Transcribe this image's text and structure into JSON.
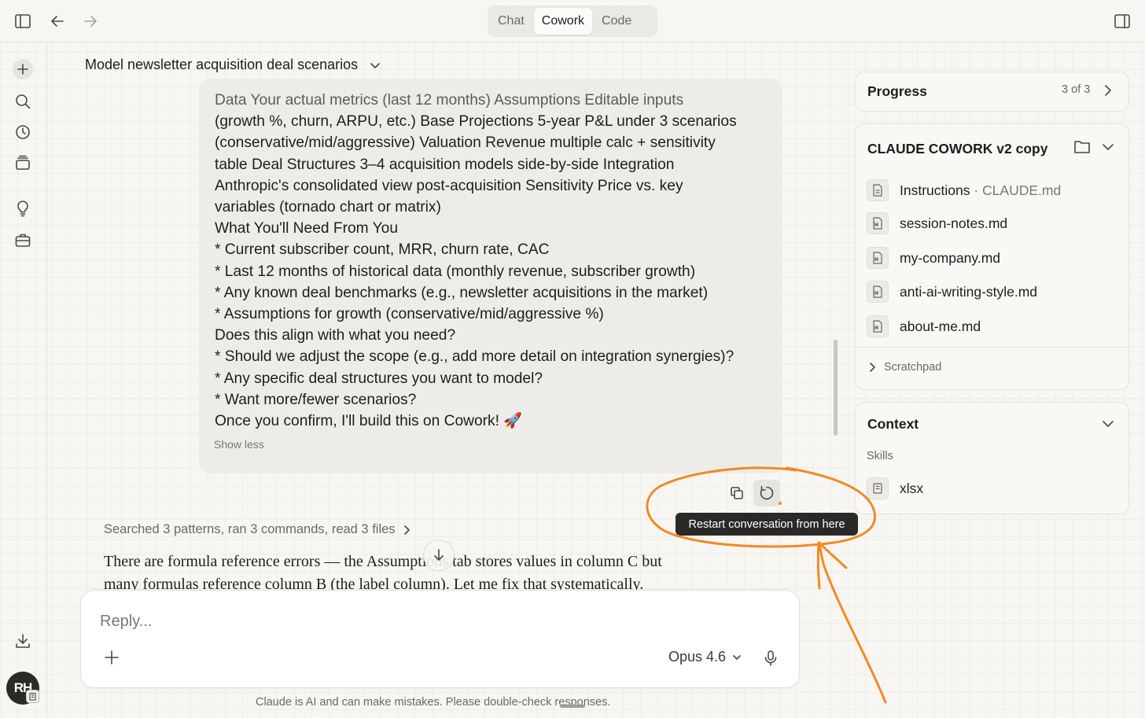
{
  "topbar": {
    "modes": [
      {
        "label": "Chat",
        "active": false
      },
      {
        "label": "Cowork",
        "active": true
      },
      {
        "label": "Code",
        "active": false
      }
    ]
  },
  "sidebar": {
    "icons": [
      "new-chat-icon",
      "search-icon",
      "history-icon",
      "projects-icon",
      "ideas-icon",
      "briefcase-icon",
      "download-icon"
    ],
    "avatar_initials": "RH"
  },
  "conversation": {
    "title": "Model newsletter acquisition deal scenarios",
    "bubble_lines": [
      "Data Your actual metrics (last 12 months) Assumptions Editable inputs",
      "(growth %, churn, ARPU, etc.) Base Projections 5-year P&L under 3 scenarios",
      "(conservative/mid/aggressive) Valuation Revenue multiple calc + sensitivity",
      "table Deal Structures 3–4 acquisition models side-by-side Integration",
      "Anthropic's consolidated view post-acquisition Sensitivity Price vs. key",
      "variables (tornado chart or matrix)",
      "What You'll Need From You",
      "* Current subscriber count, MRR, churn rate, CAC",
      "* Last 12 months of historical data (monthly revenue, subscriber growth)",
      "* Any known deal benchmarks (e.g., newsletter acquisitions in the market)",
      "* Assumptions for growth (conservative/mid/aggressive %)",
      "Does this align with what you need?",
      "* Should we adjust the scope (e.g., add more detail on integration synergies)?",
      "* Any specific deal structures you want to model?",
      "* Want more/fewer scenarios?",
      "Once you confirm, I'll build this on Cowork! 🚀"
    ],
    "show_less": "Show less",
    "tooltip": "Restart conversation from here",
    "activity": "Searched 3 patterns, ran 3 commands, read 3 files",
    "assistant_lines": [
      "There are formula reference errors — the Assumptions tab stores values in column C but",
      "many formulas reference column B (the label column). Let me fix that systematically."
    ]
  },
  "composer": {
    "placeholder": "Reply...",
    "model": "Opus 4.6",
    "disclaimer": "Claude is AI and can make mistakes. Please double-check responses."
  },
  "panel": {
    "progress": {
      "title": "Progress",
      "count": "3 of 3"
    },
    "folder": {
      "title": "CLAUDE COWORK v2 copy",
      "instructions": {
        "label": "Instructions",
        "sep": " · ",
        "file": "CLAUDE.md"
      },
      "files": [
        "session-notes.md",
        "my-company.md",
        "anti-ai-writing-style.md",
        "about-me.md"
      ],
      "scratchpad": "Scratchpad"
    },
    "context": {
      "title": "Context",
      "skills_label": "Skills",
      "skills": [
        "xlsx"
      ]
    }
  },
  "colors": {
    "background": "#f7f6f2",
    "annotation": "#f08a24",
    "tooltip_bg": "#2a2927"
  }
}
